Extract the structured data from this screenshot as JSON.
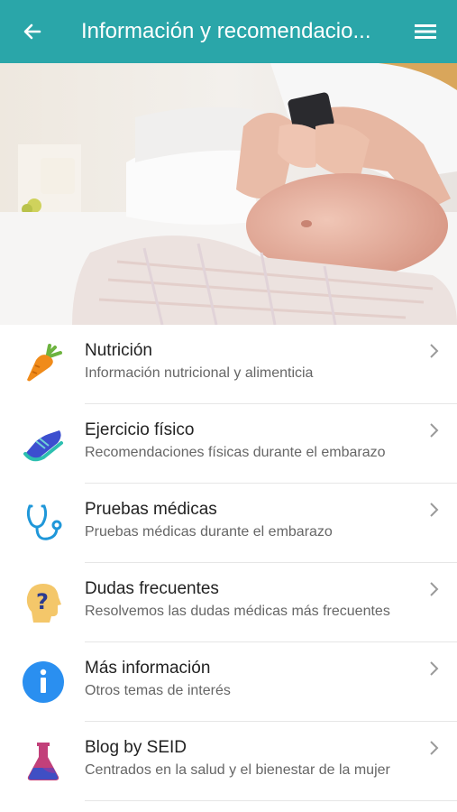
{
  "header": {
    "title": "Información y recomendacio...",
    "back_icon": "arrow-left-icon",
    "menu_icon": "hamburger-menu-icon",
    "background": "#2aa6a9"
  },
  "hero": {
    "image": "pregnant-woman-with-phone-photo"
  },
  "items": [
    {
      "title": "Nutrición",
      "subtitle": "Información nutricional y alimenticia",
      "icon": "carrot-icon"
    },
    {
      "title": "Ejercicio físico",
      "subtitle": "Recomendaciones físicas durante el embarazo",
      "icon": "sneaker-icon"
    },
    {
      "title": "Pruebas médicas",
      "subtitle": "Pruebas médicas durante el embarazo",
      "icon": "stethoscope-icon"
    },
    {
      "title": "Dudas frecuentes",
      "subtitle": "Resolvemos las dudas médicas más frecuentes",
      "icon": "question-head-icon"
    },
    {
      "title": "Más información",
      "subtitle": "Otros temas de interés",
      "icon": "info-icon"
    },
    {
      "title": "Blog by SEID",
      "subtitle": "Centrados en la salud y el bienestar de la mujer",
      "icon": "flask-icon"
    }
  ]
}
